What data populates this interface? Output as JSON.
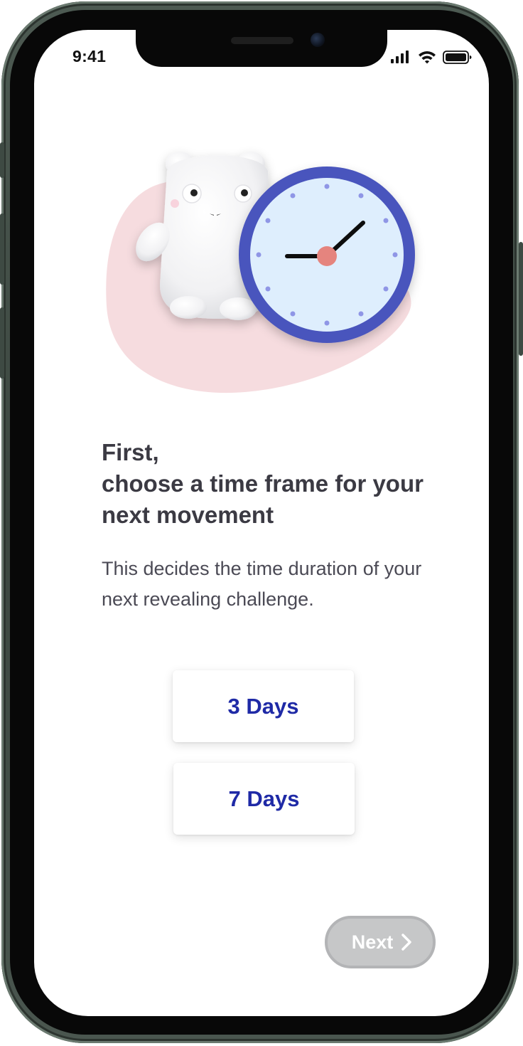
{
  "status_bar": {
    "time": "9:41",
    "icons": [
      "cellular-signal-icon",
      "wifi-icon",
      "battery-icon"
    ]
  },
  "illustration": {
    "icons": [
      "mascot-bear-icon",
      "clock-icon",
      "pink-blob-shape"
    ],
    "colors": {
      "blob": "#f6dcdf",
      "clock_ring": "#4a55bd",
      "clock_face": "#deeefd",
      "clock_hands": "#111111",
      "clock_center": "#e5847e",
      "clock_marks": "#8f96e6"
    }
  },
  "content": {
    "heading_line1": "First,",
    "heading_line2": "choose a time frame for your",
    "heading_line3": "next movement",
    "description": "This decides the time duration of your next revealing challenge."
  },
  "options": [
    {
      "label": "3 Days"
    },
    {
      "label": "7 Days"
    }
  ],
  "footer": {
    "next_label": "Next",
    "next_icon": "chevron-right-icon",
    "next_state": "disabled"
  },
  "colors": {
    "option_text": "#1f2aa6",
    "heading_text": "#3b3a43",
    "body_text": "#4b4a55",
    "next_bg": "#c6c7c8"
  }
}
